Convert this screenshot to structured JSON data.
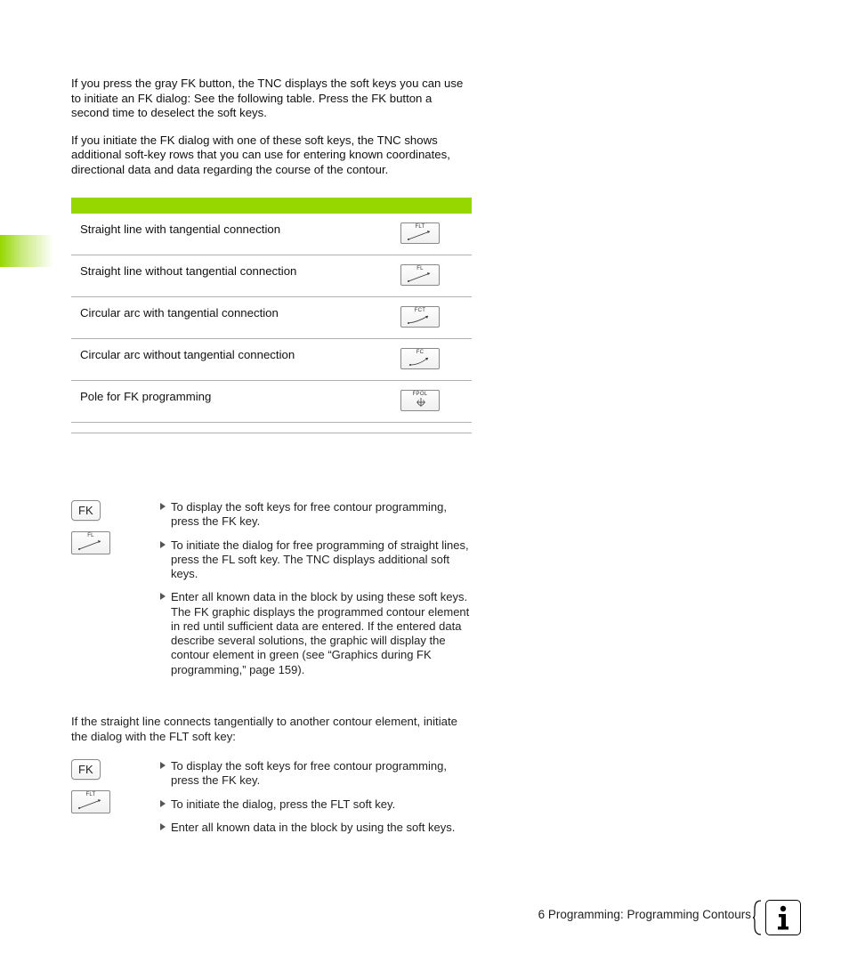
{
  "paragraphs": {
    "p1": "If you press the gray FK button, the TNC displays the soft keys you can use to initiate an FK dialog: See the following table. Press the FK button a second time to deselect the soft keys.",
    "p2": "If you initiate the FK dialog with one of these soft keys, the TNC shows additional soft-key rows that you can use for entering known coordinates, directional data and data regarding the course of the contour."
  },
  "table": {
    "rows": [
      {
        "label": "Straight line with tangential connection",
        "key_tag": "FLT",
        "icon": "line-tangent"
      },
      {
        "label": "Straight line without tangential connection",
        "key_tag": "FL",
        "icon": "line"
      },
      {
        "label": "Circular arc with tangential connection",
        "key_tag": "FCT",
        "icon": "arc-tangent"
      },
      {
        "label": "Circular arc without tangential connection",
        "key_tag": "FC",
        "icon": "arc"
      },
      {
        "label": "Pole for FK programming",
        "key_tag": "FPOL",
        "icon": "pole"
      }
    ]
  },
  "steps1": {
    "fk_label": "FK",
    "softkey_tag": "FL",
    "items": [
      "To display the soft keys for free contour programming, press the FK key.",
      "To initiate the dialog for free programming of straight lines, press the FL soft key. The TNC displays additional soft keys.",
      "Enter all known data in the block by using these soft keys. The FK graphic displays the programmed contour element in red until sufficient data are entered. If the entered data describe several solutions, the graphic will display the contour element in green (see “Graphics during FK programming,” page 159)."
    ]
  },
  "intro2": "If the straight line connects tangentially to another contour element, initiate the dialog with the FLT soft key:",
  "steps2": {
    "fk_label": "FK",
    "softkey_tag": "FLT",
    "items": [
      "To display the soft keys for free contour programming, press the FK key.",
      "To initiate the dialog, press the FLT soft key.",
      "Enter all known data in the block by using the soft keys."
    ]
  },
  "footer": "6 Programming: Programming Contours"
}
